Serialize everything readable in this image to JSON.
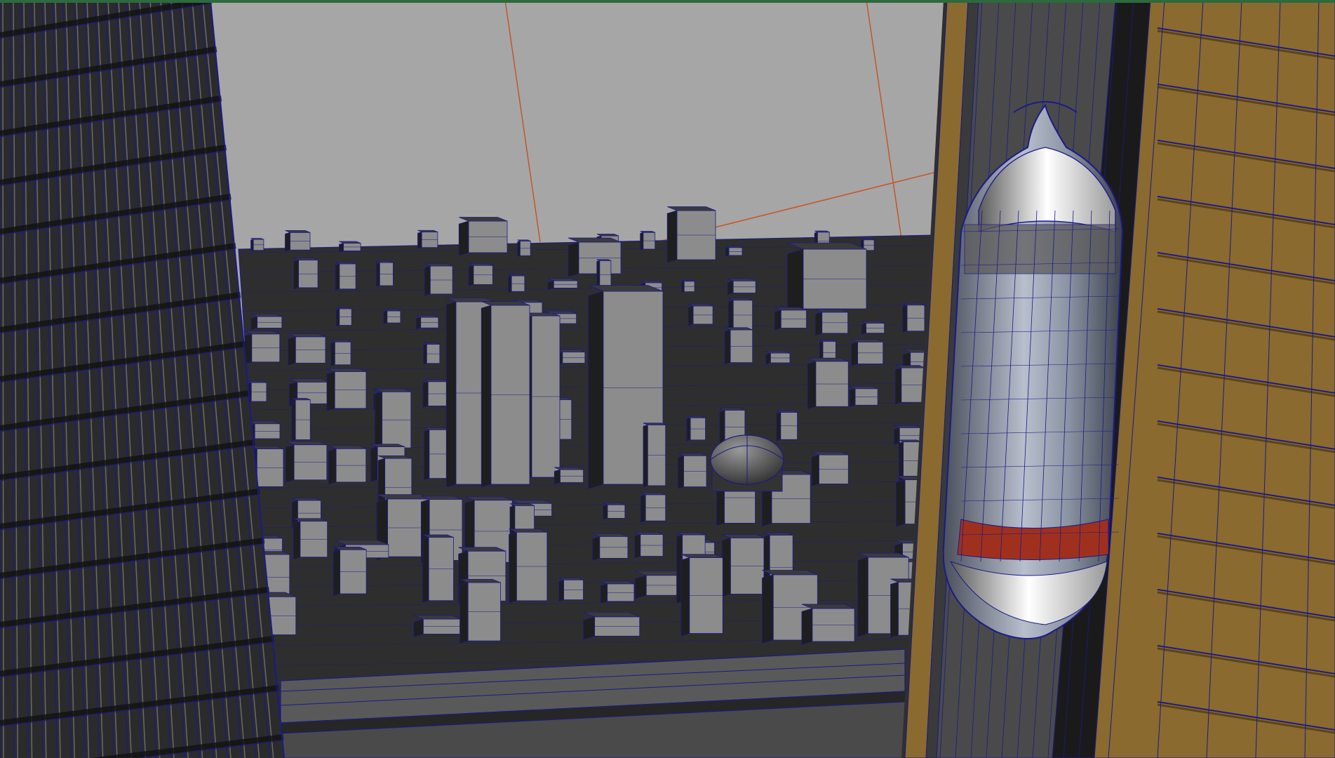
{
  "app": {
    "view": "perspective-viewport",
    "render_mode": "wireframe-on-shaded"
  },
  "colors": {
    "sky": "#a6a6a6",
    "wireframe": "#1a1a8c",
    "building_light": "#8c8c8c",
    "building_dark": "#262626",
    "camera_guides": "#c8501e",
    "facade_gold": "#8a6a2e",
    "capsule_glass": "#9aa4b4",
    "capsule_highlight": "#ffffff",
    "capsule_floor": "#a0301e",
    "viewport_border": "#2d6a3c"
  },
  "objects": {
    "left_tower": "left-skyscraper-mesh",
    "city_grid": "city-blocks-mesh",
    "elevated_road": "skyway-bridge-mesh",
    "dome": "dome-building-mesh",
    "right_tower": "right-tower-mesh",
    "elevator_capsule": "elevator-pod-mesh",
    "camera_guides": "camera-frustum-guides"
  }
}
